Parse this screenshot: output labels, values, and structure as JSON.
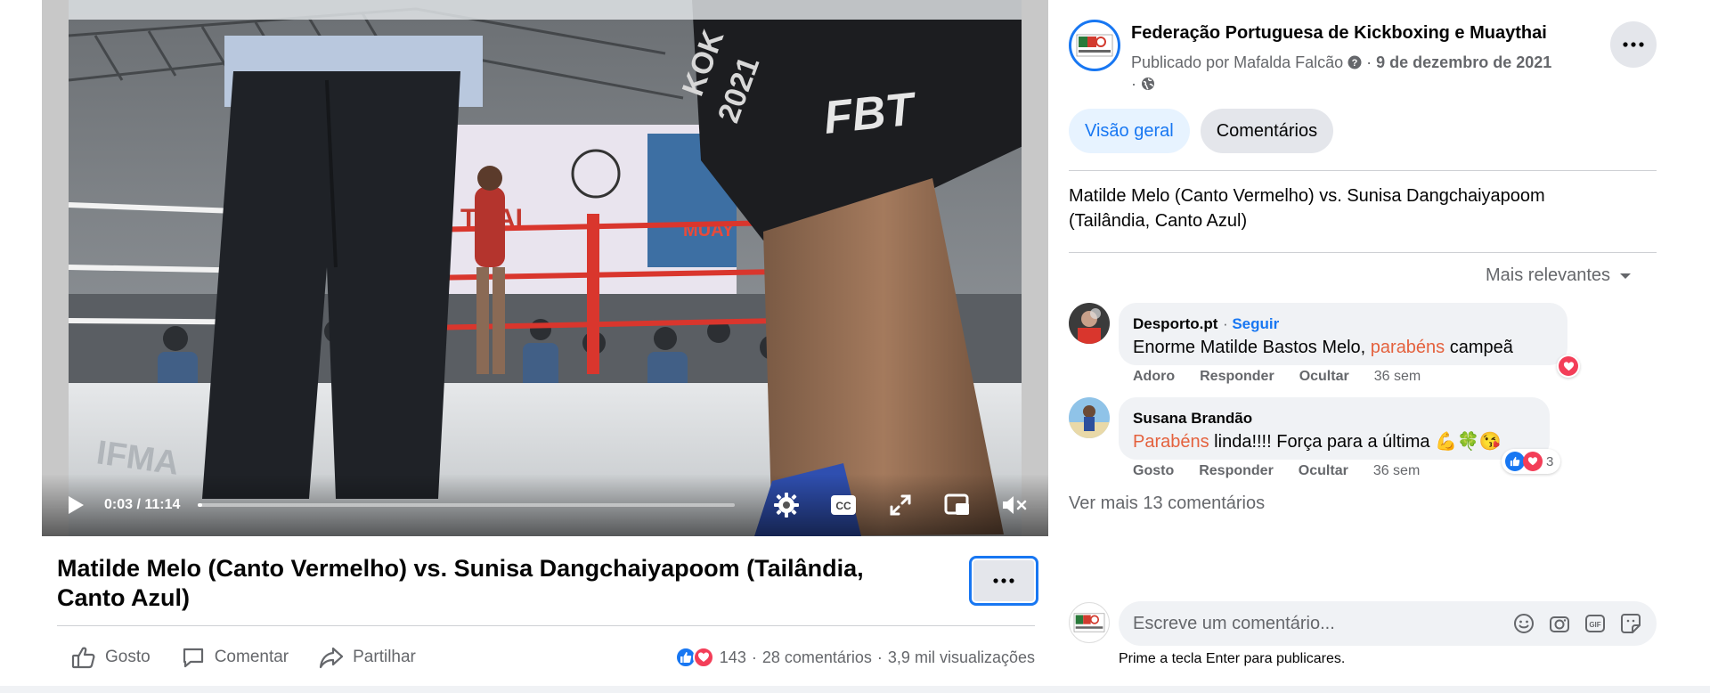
{
  "video": {
    "current_time": "0:03",
    "duration": "11:14",
    "time_display": "0:03 / 11:14",
    "progress_fraction": 0.004,
    "scene_text": [
      "FBT",
      "KOK",
      "2021",
      "MUAY",
      "THAI"
    ]
  },
  "post": {
    "title": "Matilde Melo (Canto Vermelho) vs. Sunisa Dangchaiyapoom (Tailândia, Canto Azul)",
    "actions": {
      "like_label": "Gosto",
      "comment_label": "Comentar",
      "share_label": "Partilhar"
    },
    "stats": {
      "reactions_count": "143",
      "comments": "28 comentários",
      "views": "3,9 mil visualizações",
      "separator": "·"
    }
  },
  "panel": {
    "page_name": "Federação Portuguesa de Kickboxing e Muaythai",
    "published_by": "Publicado por Mafalda Falcão",
    "date": "9 de dezembro de 2021",
    "tabs": [
      {
        "label": "Visão geral",
        "active": true
      },
      {
        "label": "Comentários",
        "active": false
      }
    ],
    "description": "Matilde Melo (Canto Vermelho) vs. Sunisa Dangchaiyapoom (Tailândia, Canto Azul)",
    "sort_label": "Mais relevantes",
    "comments": [
      {
        "author": "Desporto.pt",
        "follow": "Seguir",
        "text_before": "Enorme Matilde Bastos Melo, ",
        "highlight": "parabéns",
        "text_after": " campeã",
        "actions": [
          "Adoro",
          "Responder",
          "Ocultar"
        ],
        "time": "36 sem"
      },
      {
        "author": "Susana Brandão",
        "highlight": "Parabéns",
        "text_after": " linda!!!! Força para a última 💪🍀😘",
        "actions": [
          "Gosto",
          "Responder",
          "Ocultar"
        ],
        "time": "36 sem",
        "reaction_count": "3"
      }
    ],
    "more_comments": "Ver mais 13 comentários",
    "composer": {
      "placeholder": "Escreve um comentário...",
      "hint": "Prime a tecla Enter para publicares."
    }
  },
  "colors": {
    "accent": "#1877f2",
    "highlight": "#e4613d",
    "secondary_text": "#65676b",
    "bubble_bg": "#f0f2f5"
  }
}
